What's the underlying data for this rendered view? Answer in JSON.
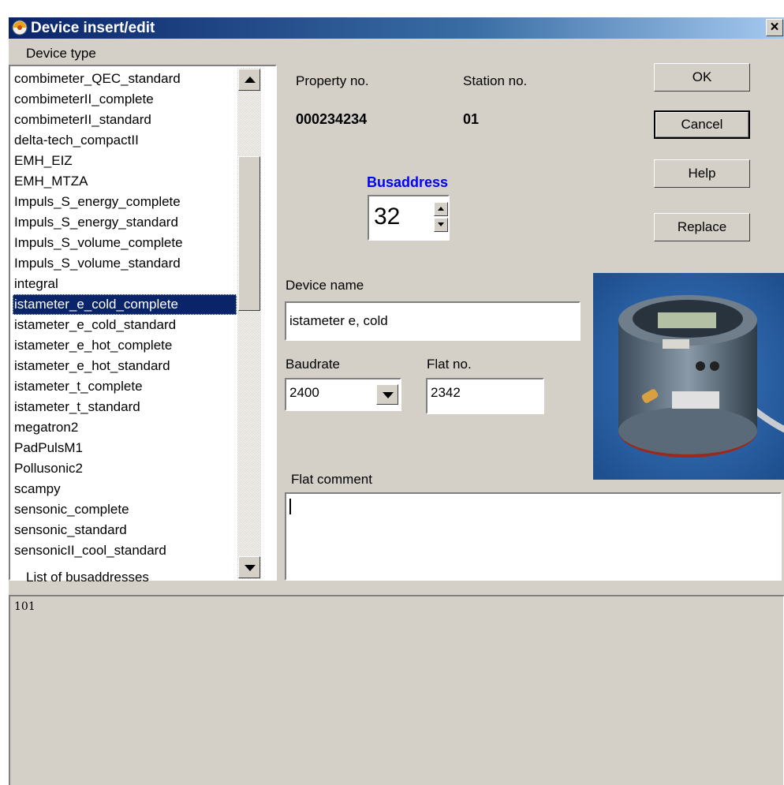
{
  "window": {
    "title": "Device insert/edit",
    "close_label": "×"
  },
  "device_type": {
    "label": "Device type",
    "items": [
      "combimeter_QEC_standard",
      "combimeterII_complete",
      "combimeterII_standard",
      "delta-tech_compactII",
      "EMH_EIZ",
      "EMH_MTZA",
      "Impuls_S_energy_complete",
      "Impuls_S_energy_standard",
      "Impuls_S_volume_complete",
      "Impuls_S_volume_standard",
      "integral",
      "istameter_e_cold_complete",
      "istameter_e_cold_standard",
      "istameter_e_hot_complete",
      "istameter_e_hot_standard",
      "istameter_t_complete",
      "istameter_t_standard",
      "megatron2",
      "PadPulsM1",
      "Pollusonic2",
      "scampy",
      "sensonic_complete",
      "sensonic_standard",
      "sensonicII_cool_standard"
    ],
    "selected": "istameter_e_cold_complete"
  },
  "property": {
    "label": "Property no.",
    "value": "000234234"
  },
  "station": {
    "label": "Station no.",
    "value": "01"
  },
  "busaddress": {
    "label": "Busaddress",
    "value": "32",
    "label_color": "#0000ff"
  },
  "device_name": {
    "label": "Device name",
    "value": "istameter e, cold"
  },
  "baudrate": {
    "label": "Baudrate",
    "value": "2400"
  },
  "flat_no": {
    "label": "Flat no.",
    "value": "2342"
  },
  "flat_comment": {
    "label": "Flat comment",
    "value": ""
  },
  "buttons": {
    "ok": "OK",
    "cancel": "Cancel",
    "help": "Help",
    "replace": "Replace"
  },
  "busaddress_list": {
    "label": "List of busaddresses",
    "items": [
      "101"
    ]
  },
  "colors": {
    "title_bar": "#0a246a",
    "selection": "#0a246a",
    "face": "#d4d0c8"
  }
}
